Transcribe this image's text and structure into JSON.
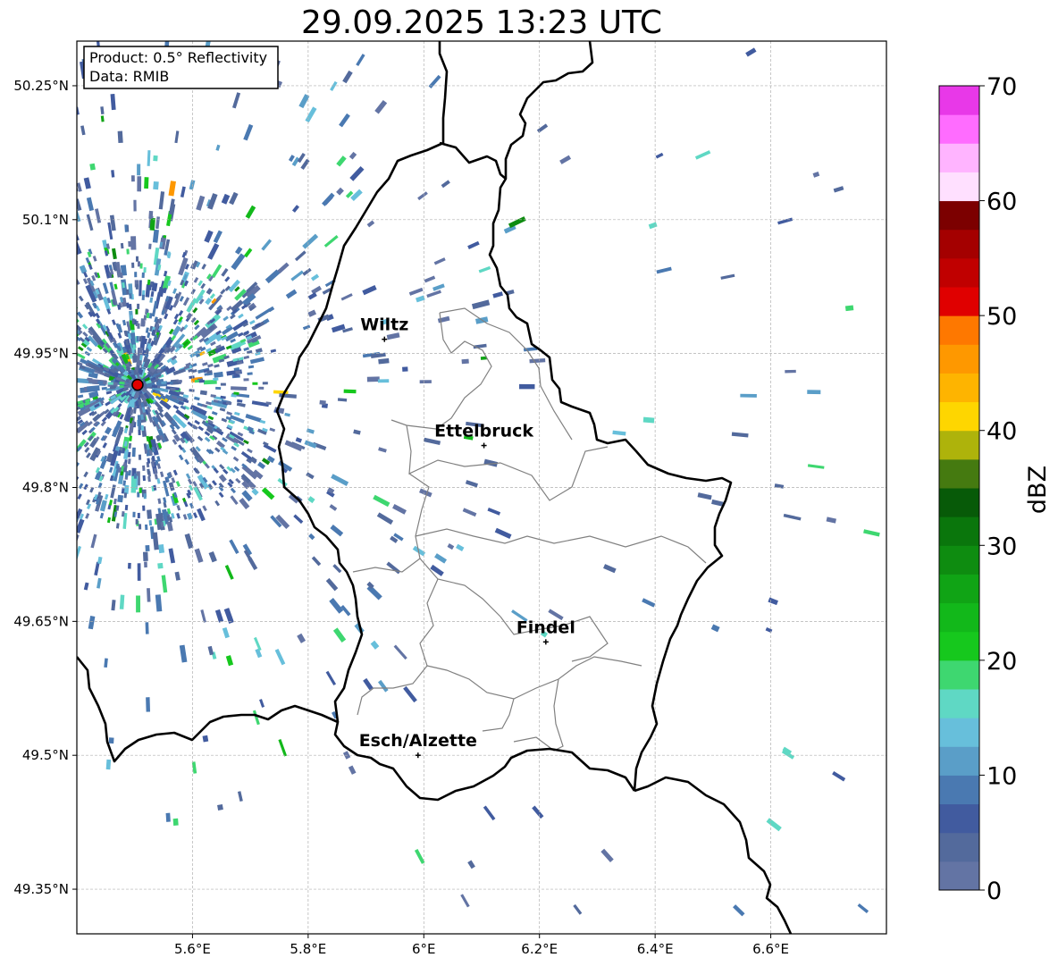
{
  "title": "29.09.2025 13:23 UTC",
  "info_box": {
    "product": "Product: 0.5° Reflectivity",
    "source": "Data: RMIB"
  },
  "map": {
    "extent": {
      "lon_min": 5.4,
      "lon_max": 6.8,
      "lat_min": 49.3,
      "lat_max": 50.3
    },
    "lon_ticks": [
      {
        "value": 5.6,
        "label": "5.6°E"
      },
      {
        "value": 5.8,
        "label": "5.8°E"
      },
      {
        "value": 6.0,
        "label": "6°E"
      },
      {
        "value": 6.2,
        "label": "6.2°E"
      },
      {
        "value": 6.4,
        "label": "6.4°E"
      },
      {
        "value": 6.6,
        "label": "6.6°E"
      }
    ],
    "lat_ticks": [
      {
        "value": 50.25,
        "label": "50.25°N"
      },
      {
        "value": 50.1,
        "label": "50.1°N"
      },
      {
        "value": 49.95,
        "label": "49.95°N"
      },
      {
        "value": 49.8,
        "label": "49.8°N"
      },
      {
        "value": 49.65,
        "label": "49.65°N"
      },
      {
        "value": 49.5,
        "label": "49.5°N"
      },
      {
        "value": 49.35,
        "label": "49.35°N"
      }
    ],
    "grid": true,
    "radar_site": {
      "lon": 5.505,
      "lat": 49.915,
      "color": "#e00000"
    },
    "cities": [
      {
        "name": "Wiltz",
        "lon": 5.932,
        "lat": 49.966
      },
      {
        "name": "Ettelbruck",
        "lon": 6.104,
        "lat": 49.847
      },
      {
        "name": "Findel",
        "lon": 6.211,
        "lat": 49.627
      },
      {
        "name": "Esch/Alzette",
        "lon": 5.99,
        "lat": 49.5
      }
    ]
  },
  "colorbar": {
    "label": "dBZ",
    "min": 0,
    "max": 70,
    "step": 2.5,
    "ticks": [
      {
        "value": 0,
        "label": "0"
      },
      {
        "value": 10,
        "label": "10"
      },
      {
        "value": 20,
        "label": "20"
      },
      {
        "value": 30,
        "label": "30"
      },
      {
        "value": 40,
        "label": "40"
      },
      {
        "value": 50,
        "label": "50"
      },
      {
        "value": 60,
        "label": "60"
      },
      {
        "value": 70,
        "label": "70"
      }
    ],
    "colors": [
      "#6374a4",
      "#536a9c",
      "#415b9f",
      "#4a79b1",
      "#5a9ec8",
      "#67bfdb",
      "#5fd8c4",
      "#3ed770",
      "#16c81d",
      "#12b81a",
      "#10a415",
      "#0e8c10",
      "#0a760c",
      "#075a08",
      "#457a10",
      "#aeb30b",
      "#fed600",
      "#feb400",
      "#fe9800",
      "#fe7800",
      "#e00000",
      "#c00000",
      "#a40000",
      "#7c0000",
      "#ffe0ff",
      "#ffb4ff",
      "#ff6cff",
      "#e838e8"
    ]
  }
}
